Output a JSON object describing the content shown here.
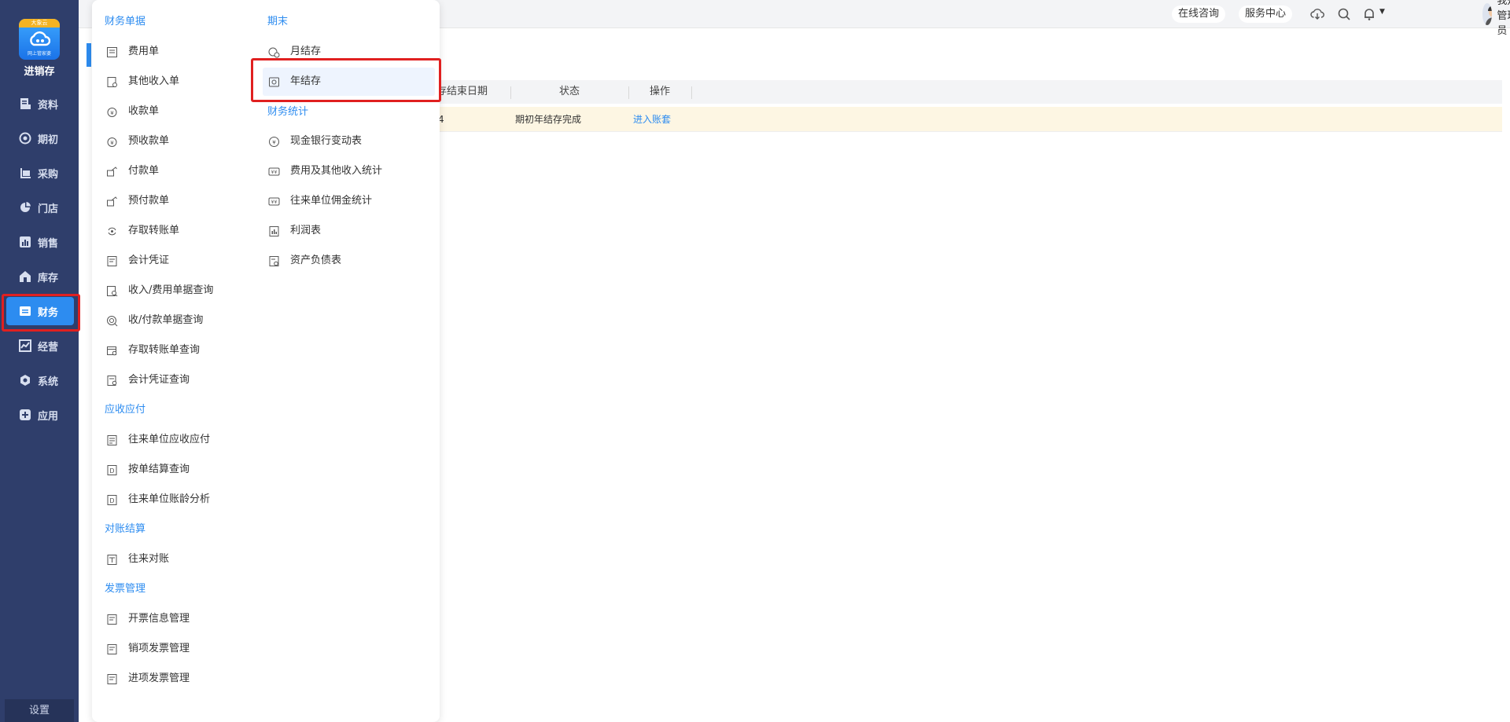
{
  "app": {
    "logo_badge": "大象云",
    "logo_small": "网上管家婆",
    "logo_text": "进销存",
    "brand_color": "#2d8cf0"
  },
  "sidebar": {
    "items": [
      {
        "label": "资料",
        "icon": "file-icon"
      },
      {
        "label": "期初",
        "icon": "target-icon"
      },
      {
        "label": "采购",
        "icon": "purchase-icon"
      },
      {
        "label": "门店",
        "icon": "pie-icon"
      },
      {
        "label": "销售",
        "icon": "bar-chart-icon"
      },
      {
        "label": "库存",
        "icon": "warehouse-icon"
      },
      {
        "label": "财务",
        "icon": "wallet-icon",
        "active": true
      },
      {
        "label": "经营",
        "icon": "trend-icon"
      },
      {
        "label": "系统",
        "icon": "gear-icon"
      },
      {
        "label": "应用",
        "icon": "plus-box-icon"
      }
    ],
    "settings_label": "设置"
  },
  "topbar": {
    "consult_label": "在线咨询",
    "service_label": "服务中心",
    "user_name": "我是管理员"
  },
  "table": {
    "headers": [
      "存结束日期",
      "状态",
      "操作"
    ],
    "row": {
      "date_fragment": "4",
      "status": "期初年结存完成",
      "action": "进入账套"
    }
  },
  "menu": {
    "col1": {
      "sections": [
        {
          "title": "财务单据",
          "items": [
            "费用单",
            "其他收入单",
            "收款单",
            "预收款单",
            "付款单",
            "预付款单",
            "存取转账单",
            "会计凭证",
            "收入/费用单据查询",
            "收/付款单据查询",
            "存取转账单查询",
            "会计凭证查询"
          ]
        },
        {
          "title": "应收应付",
          "items": [
            "往来单位应收应付",
            "按单结算查询",
            "往来单位账龄分析"
          ]
        },
        {
          "title": "对账结算",
          "items": [
            "往来对账"
          ]
        },
        {
          "title": "发票管理",
          "items": [
            "开票信息管理",
            "销项发票管理",
            "进项发票管理"
          ]
        }
      ]
    },
    "col2": {
      "sections": [
        {
          "title": "期末",
          "items": [
            "月结存",
            "年结存"
          ]
        },
        {
          "title": "财务统计",
          "items": [
            "现金银行变动表",
            "费用及其他收入统计",
            "往来单位佣金统计",
            "利润表",
            "资产负债表"
          ]
        }
      ]
    }
  }
}
